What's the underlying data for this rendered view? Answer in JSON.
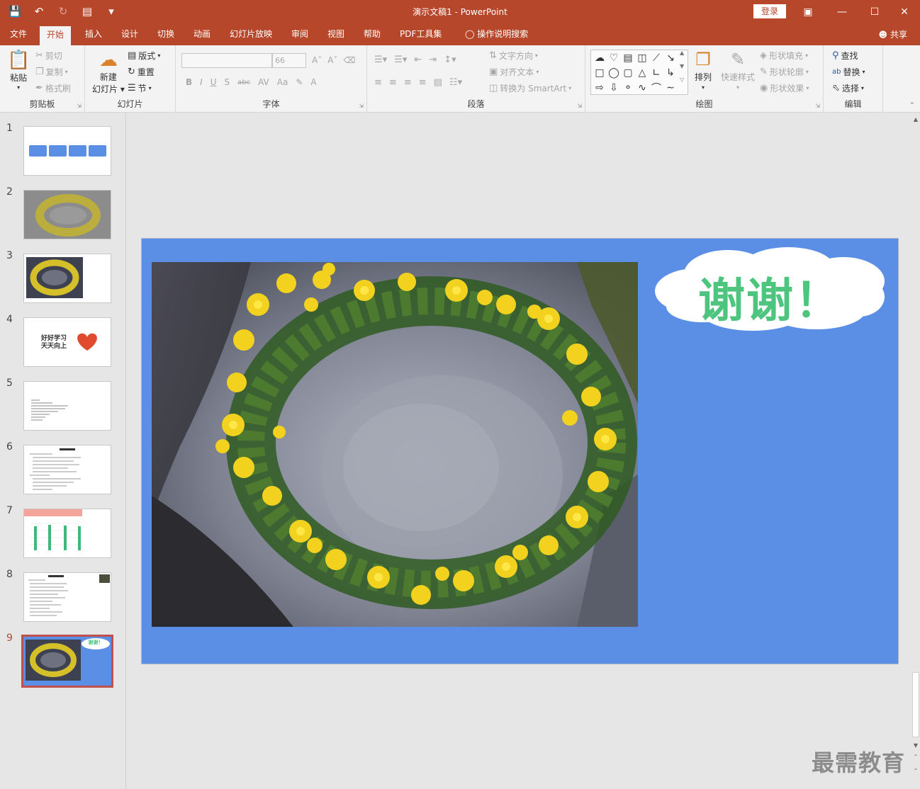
{
  "app": {
    "doc_title": "演示文稿1  -  PowerPoint",
    "login_label": "登录",
    "share_label": "共享"
  },
  "tabs": [
    {
      "label": "文件"
    },
    {
      "label": "开始",
      "active": true
    },
    {
      "label": "插入"
    },
    {
      "label": "设计"
    },
    {
      "label": "切换"
    },
    {
      "label": "动画"
    },
    {
      "label": "幻灯片放映"
    },
    {
      "label": "审阅"
    },
    {
      "label": "视图"
    },
    {
      "label": "帮助"
    },
    {
      "label": "PDF工具集"
    },
    {
      "label": "操作说明搜索"
    }
  ],
  "ribbon": {
    "clipboard": {
      "group": "剪贴板",
      "paste": "粘贴",
      "cut": "剪切",
      "copy": "复制",
      "format_painter": "格式刷"
    },
    "slides": {
      "group": "幻灯片",
      "new_slide_1": "新建",
      "new_slide_2": "幻灯片",
      "layout": "版式",
      "reset": "重置",
      "section": "节"
    },
    "font": {
      "group": "字体",
      "font_size": "66",
      "bold": "B",
      "italic": "I",
      "underline": "U",
      "shadow": "S",
      "strike": "abc",
      "spacing": "AV",
      "case": "Aa",
      "font_color": "A"
    },
    "paragraph": {
      "group": "段落",
      "text_direction": "文字方向",
      "align_text": "对齐文本",
      "smartart": "转换为 SmartArt"
    },
    "drawing": {
      "group": "绘图",
      "arrange": "排列",
      "quick_styles": "快速样式",
      "shape_fill": "形状填充",
      "shape_outline": "形状轮廓",
      "shape_effects": "形状效果"
    },
    "editing": {
      "group": "编辑",
      "find": "查找",
      "replace": "替换",
      "select": "选择"
    }
  },
  "thumbnails": [
    {
      "num": "1"
    },
    {
      "num": "2"
    },
    {
      "num": "3"
    },
    {
      "num": "4",
      "text_1": "好好学习",
      "text_2": "天天向上"
    },
    {
      "num": "5"
    },
    {
      "num": "6"
    },
    {
      "num": "7"
    },
    {
      "num": "8"
    },
    {
      "num": "9",
      "active": true,
      "cloud_text": "谢谢！"
    }
  ],
  "slide": {
    "cloud_text": "谢谢！",
    "background_color": "#5b8fe6",
    "text_color": "#4dc57f"
  },
  "watermark": "最需教育",
  "colors": {
    "accent": "#b7472a",
    "selected_thumb": "#c0504d"
  }
}
